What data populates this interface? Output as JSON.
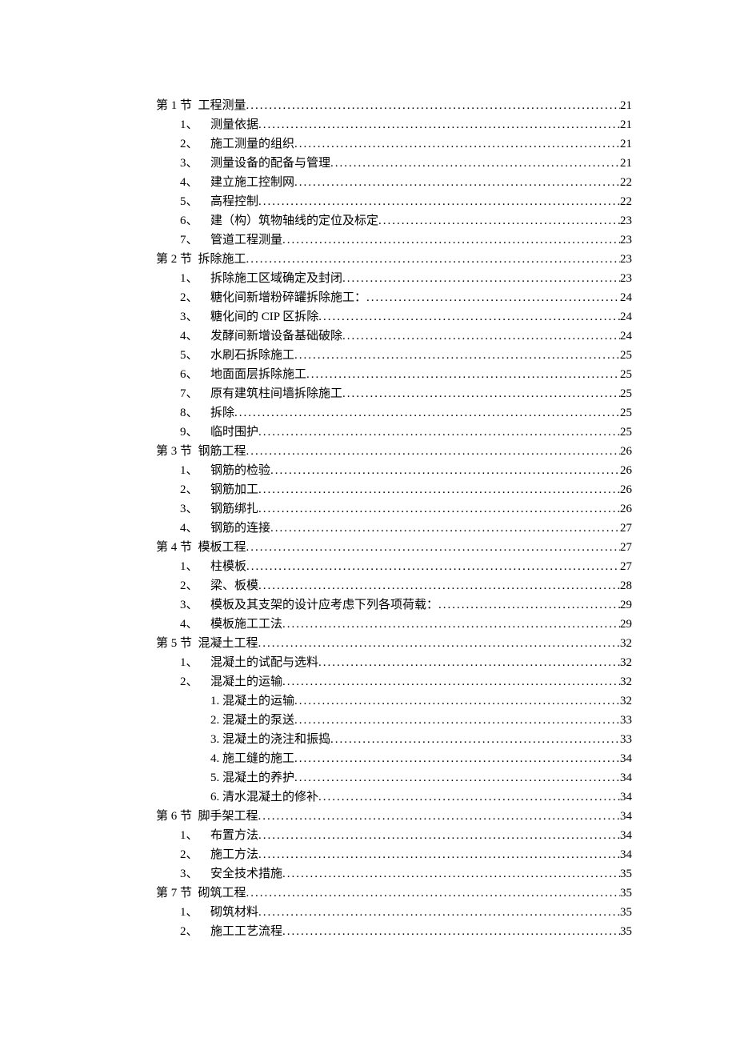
{
  "toc": [
    {
      "level": 0,
      "label": "第 1 节",
      "title": "工程测量",
      "page": "21"
    },
    {
      "level": 1,
      "label": "1、",
      "title": "测量依据",
      "page": "21"
    },
    {
      "level": 1,
      "label": "2、",
      "title": "施工测量的组织",
      "page": "21"
    },
    {
      "level": 1,
      "label": "3、",
      "title": "测量设备的配备与管理",
      "page": "21"
    },
    {
      "level": 1,
      "label": "4、",
      "title": "建立施工控制网",
      "page": "22"
    },
    {
      "level": 1,
      "label": "5、",
      "title": "高程控制",
      "page": "22"
    },
    {
      "level": 1,
      "label": "6、",
      "title": "建（构）筑物轴线的定位及标定",
      "page": "23"
    },
    {
      "level": 1,
      "label": "7、",
      "title": "管道工程测量",
      "page": "23"
    },
    {
      "level": 0,
      "label": "第 2 节",
      "title": "拆除施工",
      "page": "23"
    },
    {
      "level": 1,
      "label": "1、",
      "title": "拆除施工区域确定及封闭",
      "page": "23"
    },
    {
      "level": 1,
      "label": "2、",
      "title": "糖化间新增粉碎罐拆除施工：",
      "page": "24"
    },
    {
      "level": 1,
      "label": "3、",
      "title": "糖化间的 CIP 区拆除",
      "page": "24"
    },
    {
      "level": 1,
      "label": "4、",
      "title": "发酵间新增设备基础破除",
      "page": "24"
    },
    {
      "level": 1,
      "label": "5、",
      "title": "水刷石拆除施工",
      "page": "25"
    },
    {
      "level": 1,
      "label": "6、",
      "title": "地面面层拆除施工",
      "page": "25"
    },
    {
      "level": 1,
      "label": "7、",
      "title": "原有建筑柱间墙拆除施工",
      "page": "25"
    },
    {
      "level": 1,
      "label": "8、",
      "title": "拆除",
      "page": "25"
    },
    {
      "level": 1,
      "label": "9、",
      "title": "临时围护",
      "page": "25"
    },
    {
      "level": 0,
      "label": "第 3 节",
      "title": "钢筋工程",
      "page": "26"
    },
    {
      "level": 1,
      "label": "1、",
      "title": "钢筋的检验",
      "page": "26"
    },
    {
      "level": 1,
      "label": "2、",
      "title": "钢筋加工",
      "page": "26"
    },
    {
      "level": 1,
      "label": "3、",
      "title": "钢筋绑扎",
      "page": "26"
    },
    {
      "level": 1,
      "label": "4、",
      "title": "钢筋的连接",
      "page": "27"
    },
    {
      "level": 0,
      "label": "第 4 节",
      "title": "模板工程",
      "page": "27"
    },
    {
      "level": 1,
      "label": "1、",
      "title": "柱模板",
      "page": "27"
    },
    {
      "level": 1,
      "label": "2、",
      "title": "梁、板模",
      "page": "28"
    },
    {
      "level": 1,
      "label": "3、",
      "title": "模板及其支架的设计应考虑下列各项荷载：",
      "page": "29"
    },
    {
      "level": 1,
      "label": "4、",
      "title": "模板施工工法",
      "page": "29"
    },
    {
      "level": 0,
      "label": "第 5 节",
      "title": "混凝土工程",
      "page": "32"
    },
    {
      "level": 1,
      "label": "1、",
      "title": "混凝土的试配与选料",
      "page": "32"
    },
    {
      "level": 1,
      "label": "2、",
      "title": "混凝土的运输",
      "page": "32"
    },
    {
      "level": 2,
      "label": "",
      "title": "1. 混凝土的运输",
      "page": "32"
    },
    {
      "level": 2,
      "label": "",
      "title": "2. 混凝土的泵送",
      "page": "33"
    },
    {
      "level": 2,
      "label": "",
      "title": "3. 混凝土的浇注和振捣",
      "page": "33"
    },
    {
      "level": 2,
      "label": "",
      "title": "4. 施工缝的施工",
      "page": "34"
    },
    {
      "level": 2,
      "label": "",
      "title": "5. 混凝土的养护",
      "page": "34"
    },
    {
      "level": 2,
      "label": "",
      "title": "6. 清水混凝土的修补",
      "page": "34"
    },
    {
      "level": 0,
      "label": "第 6 节",
      "title": "脚手架工程",
      "page": "34"
    },
    {
      "level": 1,
      "label": "1、",
      "title": "布置方法",
      "page": "34"
    },
    {
      "level": 1,
      "label": "2、",
      "title": "施工方法",
      "page": "34"
    },
    {
      "level": 1,
      "label": "3、",
      "title": "安全技术措施",
      "page": "35"
    },
    {
      "level": 0,
      "label": "第 7 节",
      "title": "砌筑工程",
      "page": "35"
    },
    {
      "level": 1,
      "label": "1、",
      "title": "砌筑材料",
      "page": "35"
    },
    {
      "level": 1,
      "label": "2、",
      "title": "施工工艺流程",
      "page": "35"
    }
  ]
}
